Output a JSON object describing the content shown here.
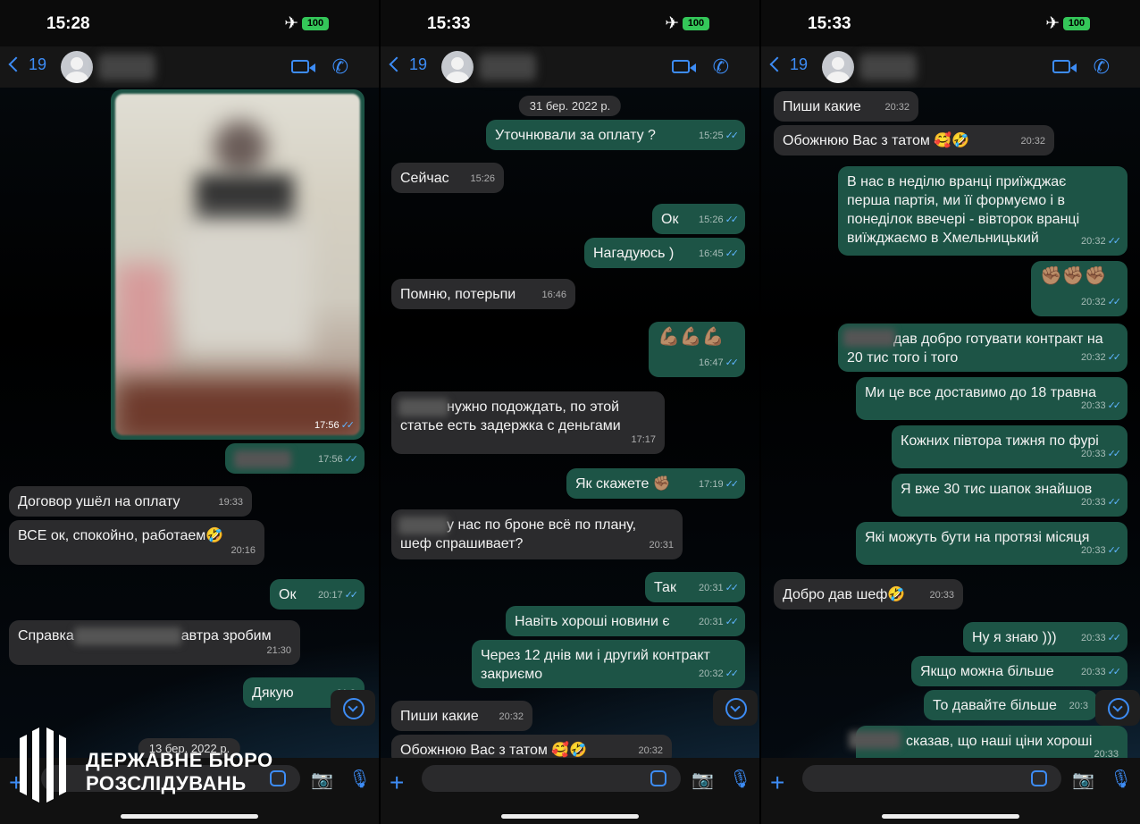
{
  "panels": [
    {
      "status": {
        "time": "15:28",
        "battery": "100"
      },
      "nav": {
        "back_count": "19"
      },
      "date_pill": "13 бер. 2022 р.",
      "media_time": "17:56",
      "messages": [
        {
          "text": "",
          "time": "17:56"
        },
        {
          "text": "Договор ушёл на оплату",
          "time": "19:33"
        },
        {
          "text": "ВСЕ ок, спокойно, работаем🤣",
          "time": "20:16"
        },
        {
          "text": "Ок",
          "time": "20:17"
        },
        {
          "text_before": "Справка",
          "text_after": "автра зробим",
          "time": "21:30"
        },
        {
          "text": "Дякую",
          "time": "21:3"
        }
      ]
    },
    {
      "status": {
        "time": "15:33",
        "battery": "100"
      },
      "nav": {
        "back_count": "19"
      },
      "date_pill": "31 бер. 2022 р.",
      "messages": [
        {
          "text": "Уточнювали за оплату ?",
          "time": "15:25"
        },
        {
          "text": "Сейчас",
          "time": "15:26"
        },
        {
          "text": "Ок",
          "time": "15:26"
        },
        {
          "text": "Нагадуюсь )",
          "time": "16:45"
        },
        {
          "text": "Помню, потерьпи",
          "time": "16:46"
        },
        {
          "text": "💪🏽💪🏽💪🏽",
          "time": "16:47"
        },
        {
          "text": "нужно подождать, по этой\nстатье есть задержка с деньгами",
          "time": "17:17"
        },
        {
          "text": "Як скажете ✊🏽",
          "time": "17:19"
        },
        {
          "text": "у нас по броне всё по плану,\nшеф спрашивает?",
          "time": "20:31"
        },
        {
          "text": "Так",
          "time": "20:31"
        },
        {
          "text": "Навіть хороші новини є",
          "time": "20:31"
        },
        {
          "text": "Через 12 днів ми і другий контракт\nзакриємо",
          "time": "20:32"
        },
        {
          "text": "Пиши какие",
          "time": "20:32"
        },
        {
          "text": "Обожнюю Вас з татом 🥰🤣",
          "time": "20:32"
        }
      ]
    },
    {
      "status": {
        "time": "15:33",
        "battery": "100"
      },
      "nav": {
        "back_count": "19"
      },
      "messages": [
        {
          "text": "Пиши какие",
          "time": "20:32"
        },
        {
          "text": "Обожнюю Вас з татом 🥰🤣",
          "time": "20:32"
        },
        {
          "text": "В нас в неділю вранці приїжджає\nперша партія, ми її формуємо і в\nпонеділок ввечері - вівторок вранці\nвиїжджаємо в Хмельницький",
          "time": "20:32"
        },
        {
          "text": "✊🏽✊🏽✊🏽",
          "time": "20:32"
        },
        {
          "text": "дав добро готувати контракт на\n20 тис того і того",
          "time": "20:32"
        },
        {
          "text": "Ми це все доставимо до 18 травна",
          "time": "20:33"
        },
        {
          "text": "Кожних півтора тижня по фурі",
          "time": "20:33"
        },
        {
          "text": "Я вже 30 тис шапок знайшов",
          "time": "20:33"
        },
        {
          "text": "Які можуть бути на протязі місяця",
          "time": "20:33"
        },
        {
          "text": "Добро дав шеф🤣",
          "time": "20:33"
        },
        {
          "text": "Ну я знаю )))",
          "time": "20:33"
        },
        {
          "text": "Якщо можна більше",
          "time": "20:33"
        },
        {
          "text": "То давайте більше",
          "time": "20:3"
        },
        {
          "text": "сказав, що наші ціни хороші",
          "time": "20:33"
        }
      ]
    }
  ],
  "logo": {
    "line1": "ДЕРЖАВНЕ БЮРО",
    "line2": "РОЗСЛІДУВАНЬ"
  },
  "colors": {
    "incoming": "#2b2b2d",
    "outgoing": "#1d5446",
    "accent": "#3d8cf5",
    "battery": "#34c759"
  }
}
